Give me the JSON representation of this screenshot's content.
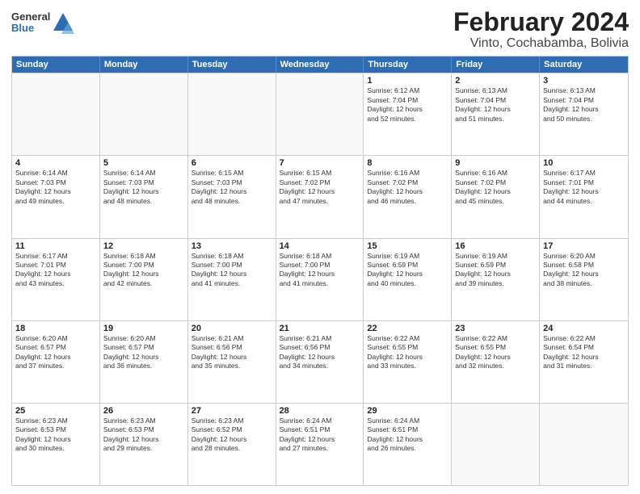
{
  "header": {
    "logo": {
      "general": "General",
      "blue": "Blue"
    },
    "title": "February 2024",
    "subtitle": "Vinto, Cochabamba, Bolivia"
  },
  "days_of_week": [
    "Sunday",
    "Monday",
    "Tuesday",
    "Wednesday",
    "Thursday",
    "Friday",
    "Saturday"
  ],
  "weeks": [
    [
      {
        "day": "",
        "data": "",
        "empty": true
      },
      {
        "day": "",
        "data": "",
        "empty": true
      },
      {
        "day": "",
        "data": "",
        "empty": true
      },
      {
        "day": "",
        "data": "",
        "empty": true
      },
      {
        "day": "1",
        "data": "Sunrise: 6:12 AM\nSunset: 7:04 PM\nDaylight: 12 hours\nand 52 minutes."
      },
      {
        "day": "2",
        "data": "Sunrise: 6:13 AM\nSunset: 7:04 PM\nDaylight: 12 hours\nand 51 minutes."
      },
      {
        "day": "3",
        "data": "Sunrise: 6:13 AM\nSunset: 7:04 PM\nDaylight: 12 hours\nand 50 minutes."
      }
    ],
    [
      {
        "day": "4",
        "data": "Sunrise: 6:14 AM\nSunset: 7:03 PM\nDaylight: 12 hours\nand 49 minutes."
      },
      {
        "day": "5",
        "data": "Sunrise: 6:14 AM\nSunset: 7:03 PM\nDaylight: 12 hours\nand 48 minutes."
      },
      {
        "day": "6",
        "data": "Sunrise: 6:15 AM\nSunset: 7:03 PM\nDaylight: 12 hours\nand 48 minutes."
      },
      {
        "day": "7",
        "data": "Sunrise: 6:15 AM\nSunset: 7:02 PM\nDaylight: 12 hours\nand 47 minutes."
      },
      {
        "day": "8",
        "data": "Sunrise: 6:16 AM\nSunset: 7:02 PM\nDaylight: 12 hours\nand 46 minutes."
      },
      {
        "day": "9",
        "data": "Sunrise: 6:16 AM\nSunset: 7:02 PM\nDaylight: 12 hours\nand 45 minutes."
      },
      {
        "day": "10",
        "data": "Sunrise: 6:17 AM\nSunset: 7:01 PM\nDaylight: 12 hours\nand 44 minutes."
      }
    ],
    [
      {
        "day": "11",
        "data": "Sunrise: 6:17 AM\nSunset: 7:01 PM\nDaylight: 12 hours\nand 43 minutes."
      },
      {
        "day": "12",
        "data": "Sunrise: 6:18 AM\nSunset: 7:00 PM\nDaylight: 12 hours\nand 42 minutes."
      },
      {
        "day": "13",
        "data": "Sunrise: 6:18 AM\nSunset: 7:00 PM\nDaylight: 12 hours\nand 41 minutes."
      },
      {
        "day": "14",
        "data": "Sunrise: 6:18 AM\nSunset: 7:00 PM\nDaylight: 12 hours\nand 41 minutes."
      },
      {
        "day": "15",
        "data": "Sunrise: 6:19 AM\nSunset: 6:59 PM\nDaylight: 12 hours\nand 40 minutes."
      },
      {
        "day": "16",
        "data": "Sunrise: 6:19 AM\nSunset: 6:59 PM\nDaylight: 12 hours\nand 39 minutes."
      },
      {
        "day": "17",
        "data": "Sunrise: 6:20 AM\nSunset: 6:58 PM\nDaylight: 12 hours\nand 38 minutes."
      }
    ],
    [
      {
        "day": "18",
        "data": "Sunrise: 6:20 AM\nSunset: 6:57 PM\nDaylight: 12 hours\nand 37 minutes."
      },
      {
        "day": "19",
        "data": "Sunrise: 6:20 AM\nSunset: 6:57 PM\nDaylight: 12 hours\nand 36 minutes."
      },
      {
        "day": "20",
        "data": "Sunrise: 6:21 AM\nSunset: 6:56 PM\nDaylight: 12 hours\nand 35 minutes."
      },
      {
        "day": "21",
        "data": "Sunrise: 6:21 AM\nSunset: 6:56 PM\nDaylight: 12 hours\nand 34 minutes."
      },
      {
        "day": "22",
        "data": "Sunrise: 6:22 AM\nSunset: 6:55 PM\nDaylight: 12 hours\nand 33 minutes."
      },
      {
        "day": "23",
        "data": "Sunrise: 6:22 AM\nSunset: 6:55 PM\nDaylight: 12 hours\nand 32 minutes."
      },
      {
        "day": "24",
        "data": "Sunrise: 6:22 AM\nSunset: 6:54 PM\nDaylight: 12 hours\nand 31 minutes."
      }
    ],
    [
      {
        "day": "25",
        "data": "Sunrise: 6:23 AM\nSunset: 6:53 PM\nDaylight: 12 hours\nand 30 minutes."
      },
      {
        "day": "26",
        "data": "Sunrise: 6:23 AM\nSunset: 6:53 PM\nDaylight: 12 hours\nand 29 minutes."
      },
      {
        "day": "27",
        "data": "Sunrise: 6:23 AM\nSunset: 6:52 PM\nDaylight: 12 hours\nand 28 minutes."
      },
      {
        "day": "28",
        "data": "Sunrise: 6:24 AM\nSunset: 6:51 PM\nDaylight: 12 hours\nand 27 minutes."
      },
      {
        "day": "29",
        "data": "Sunrise: 6:24 AM\nSunset: 6:51 PM\nDaylight: 12 hours\nand 26 minutes."
      },
      {
        "day": "",
        "data": "",
        "empty": true
      },
      {
        "day": "",
        "data": "",
        "empty": true
      }
    ]
  ]
}
